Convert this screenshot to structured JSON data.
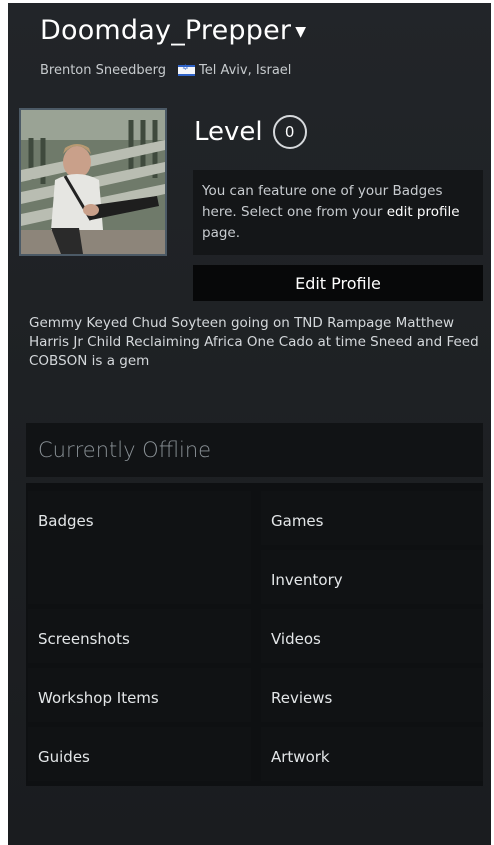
{
  "profile": {
    "username": "Doomday_Prepper",
    "real_name": "Brenton Sneedberg",
    "location": "Tel Aviv, Israel",
    "level_label": "Level",
    "level_value": "0",
    "badge_text_1": "You can feature one of your Badges here. Select one from your ",
    "badge_link": "edit profile",
    "badge_text_2": " page.",
    "edit_button": "Edit Profile",
    "summary": "Gemmy Keyed Chud Soyteen going on TND Rampage Matthew Harris Jr Child Reclaiming Africa One Cado at time Sneed and Feed COBSON is a gem"
  },
  "status": "Currently Offline",
  "links": {
    "badges": "Badges",
    "games": "Games",
    "inventory": "Inventory",
    "screenshots": "Screenshots",
    "videos": "Videos",
    "workshop": "Workshop Items",
    "reviews": "Reviews",
    "guides": "Guides",
    "artwork": "Artwork"
  },
  "colors": {
    "background": "#1f2225",
    "panel": "#101214",
    "accent_flag": "#2f63c8"
  }
}
